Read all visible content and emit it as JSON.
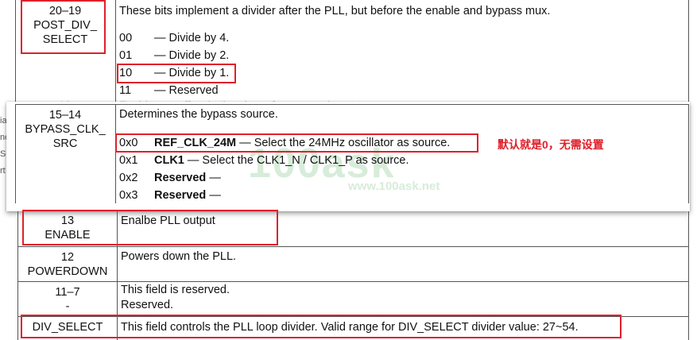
{
  "top_row": {
    "field_line1": "20–19",
    "field_line2": "POST_DIV_",
    "field_line3": "SELECT",
    "description": "These bits implement a divider after the PLL, but before the enable and bypass mux.",
    "options": [
      {
        "code": "00",
        "text": "— Divide by 4."
      },
      {
        "code": "01",
        "text": "— Divide by 2."
      },
      {
        "code": "10",
        "text": "— Divide by 1."
      },
      {
        "code": "11",
        "text": "— Reserved"
      }
    ]
  },
  "ghost_text": "Enables an offset in the phase frequency detector.",
  "ghost_field": "13",
  "left_margin_fragments": [
    "ia",
    "nc",
    "Se",
    "rt"
  ],
  "bypass_row": {
    "field_line1": "15–14",
    "field_line2": "BYPASS_CLK_",
    "field_line3": "SRC",
    "description": "Determines the bypass source.",
    "options": [
      {
        "code": "0x0",
        "name": "REF_CLK_24M",
        "text": " — Select the 24MHz oscillator as source."
      },
      {
        "code": "0x1",
        "name": "CLK1",
        "text": " — Select the CLK1_N / CLK1_P as source."
      },
      {
        "code": "0x2",
        "name": "Reserved",
        "text": " —"
      },
      {
        "code": "0x3",
        "name": "Reserved",
        "text": " —"
      }
    ]
  },
  "annotation_note": "默认就是0，无需设置",
  "watermark": {
    "big": "100ask",
    "small": "www.100ask.net"
  },
  "enable_row": {
    "field_line1": "13",
    "field_line2": "ENABLE",
    "description": "Enalbe PLL output"
  },
  "powerdown_row": {
    "field_line1": "12",
    "field_line2": "POWERDOWN",
    "description": "Powers down the PLL."
  },
  "reserved_row": {
    "field_line1": "11–7",
    "field_line2": "-",
    "description_line1": "This field is reserved.",
    "description_line2": "Reserved."
  },
  "divselect_row": {
    "field_line1": "DIV_SELECT",
    "description": "This field controls the PLL loop divider. Valid range for DIV_SELECT divider value: 27~54."
  },
  "colors": {
    "highlight_box": "#e0202a",
    "grid": "#555555",
    "watermark": "#d7ecd9"
  }
}
